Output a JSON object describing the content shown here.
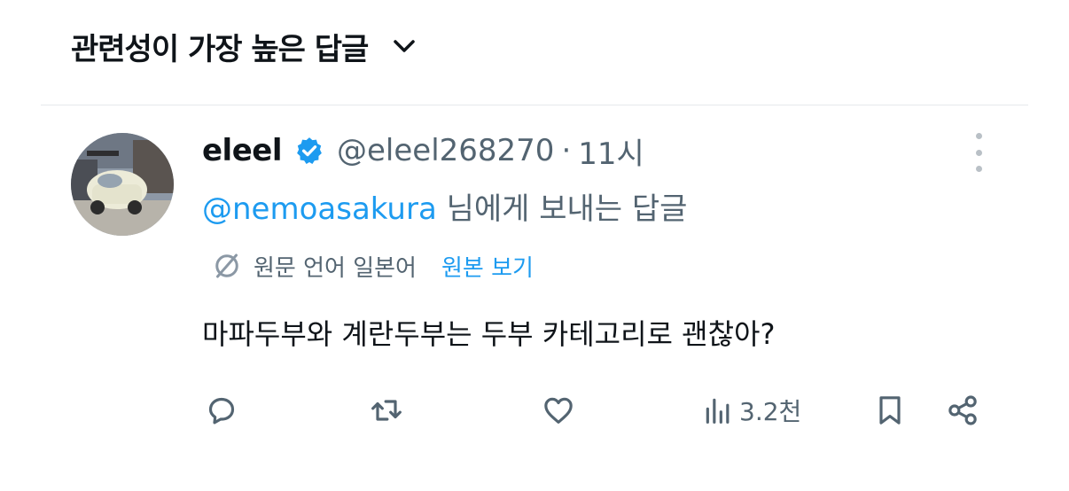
{
  "sort": {
    "label": "관련성이 가장 높은 답글",
    "icon": "chevron-down-icon"
  },
  "tweet": {
    "author": {
      "display_name": "eleel",
      "handle": "@eleel268270",
      "verified": true,
      "avatar_icon": "avatar-image"
    },
    "separator": "·",
    "time": "11시",
    "reply_to": {
      "mention": "@nemoasakura",
      "suffix": " 님에게 보내는 답글"
    },
    "translation": {
      "icon": "translate-off-icon",
      "label": "원문 언어 일본어",
      "show_original": "원본 보기"
    },
    "text": "마파두부와 계란두부는 두부 카테고리로 괜찮아?",
    "actions": {
      "reply": {
        "icon": "reply-icon"
      },
      "retweet": {
        "icon": "retweet-icon"
      },
      "like": {
        "icon": "heart-icon"
      },
      "views": {
        "icon": "views-icon",
        "count": "3.2천"
      },
      "bookmark": {
        "icon": "bookmark-icon"
      },
      "share": {
        "icon": "share-icon"
      }
    }
  },
  "colors": {
    "accent": "#1d9bf0",
    "secondary_text": "#536471",
    "primary_text": "#0f1419",
    "divider": "#e6e9ec"
  }
}
